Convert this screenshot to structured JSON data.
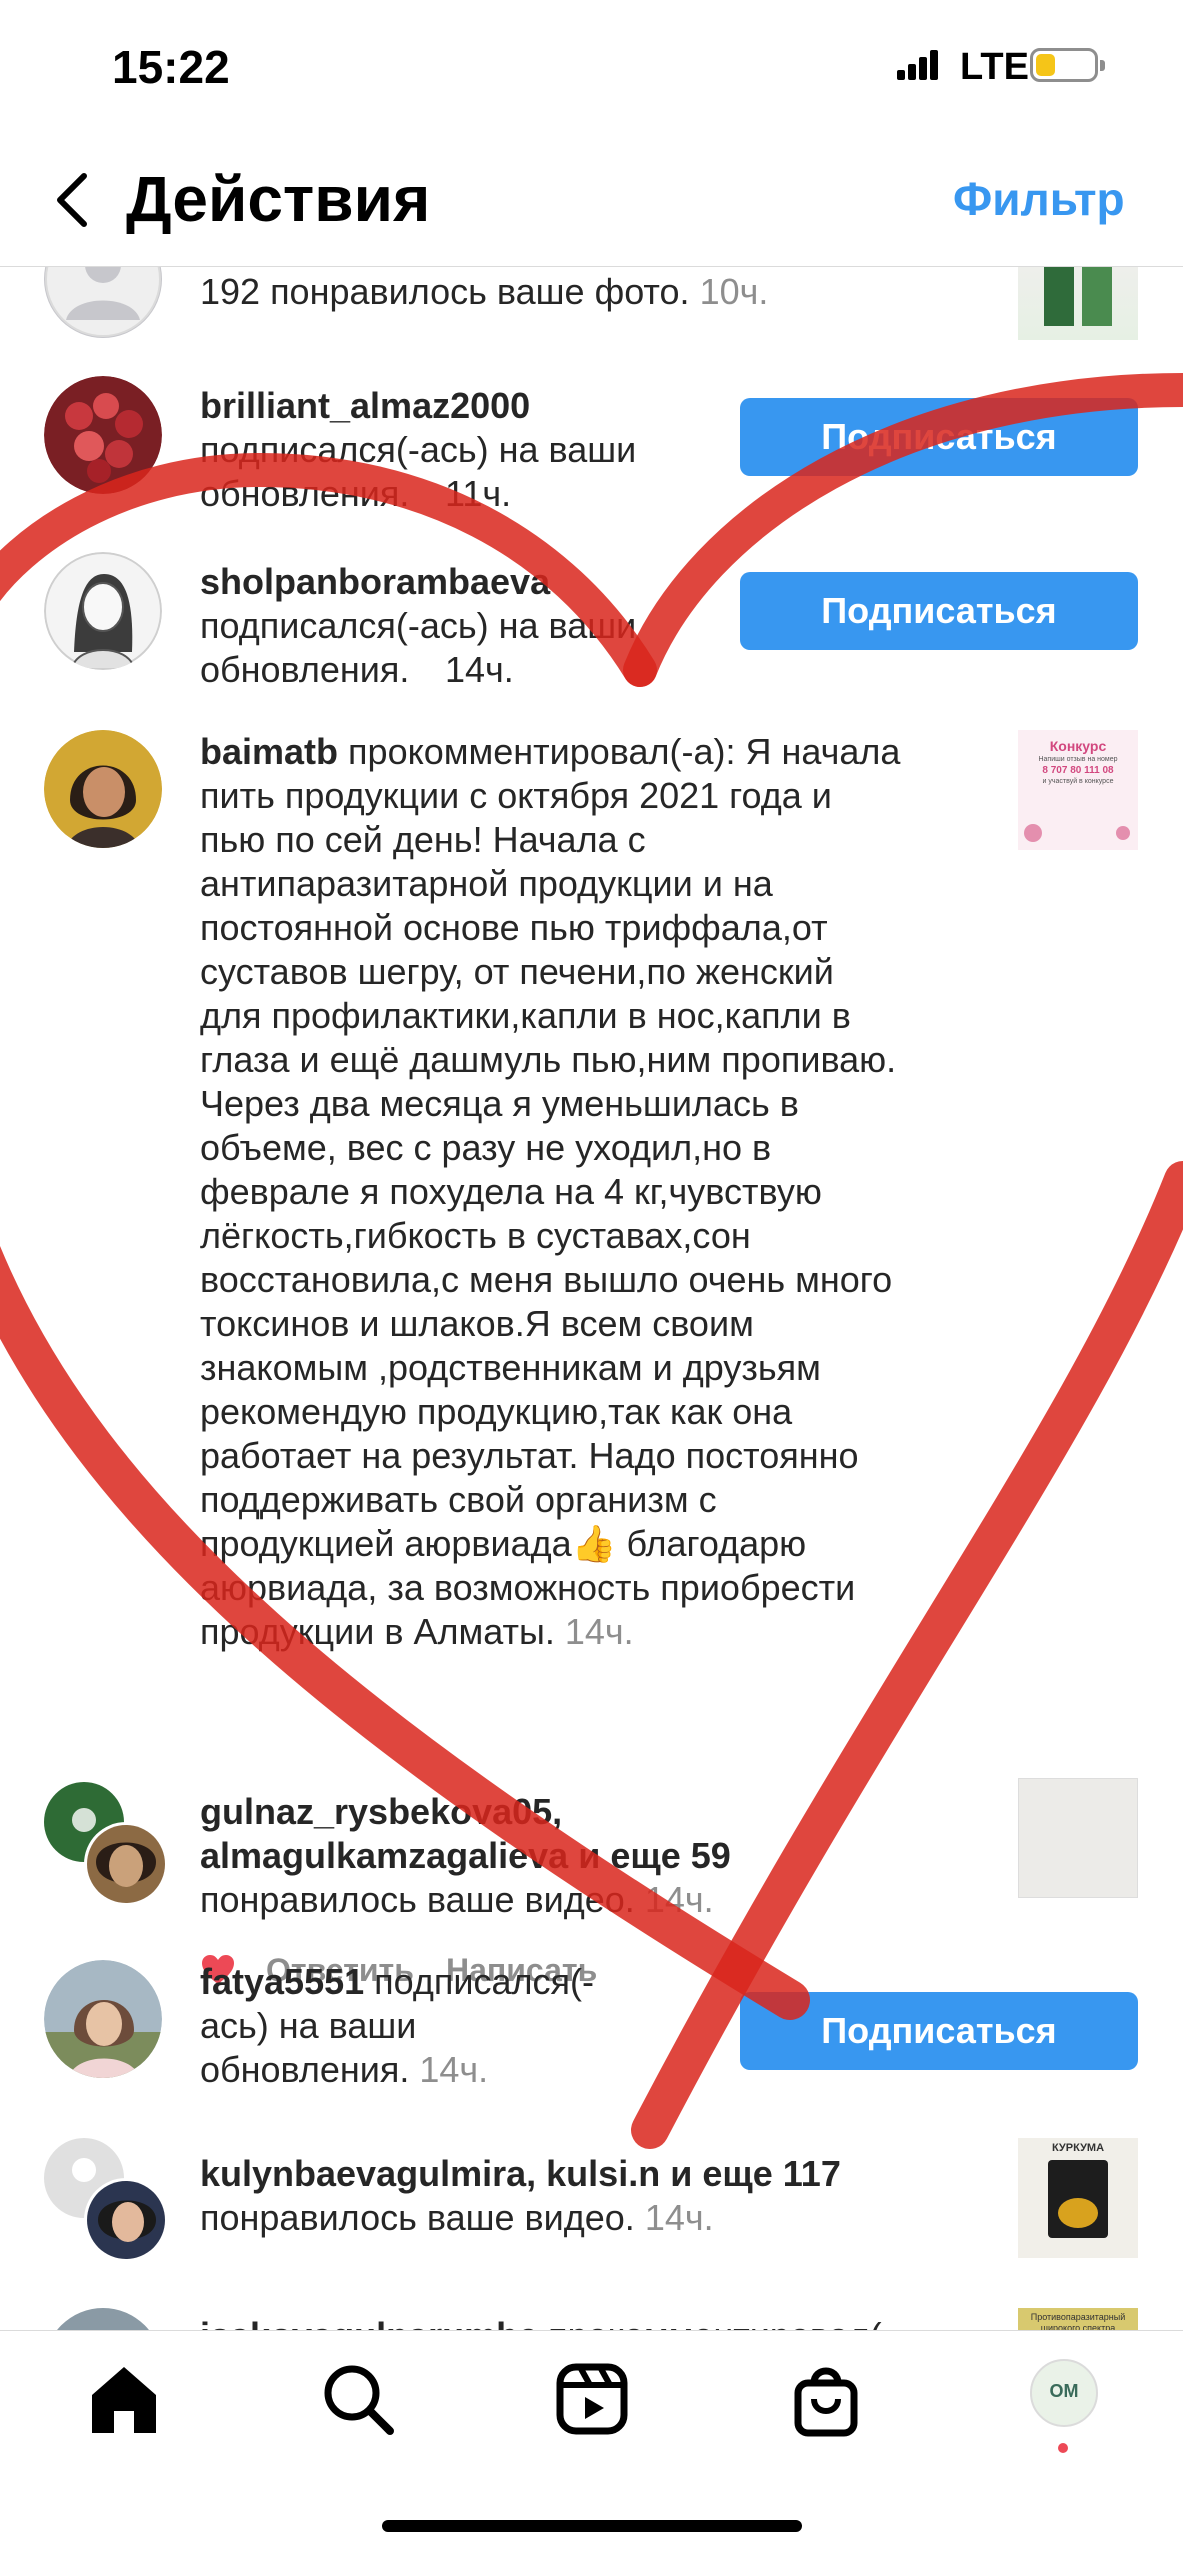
{
  "status": {
    "time": "15:22",
    "network": "LTE"
  },
  "header": {
    "title": "Действия",
    "filter": "Фильтр"
  },
  "rows": [
    {
      "text": "192 понравилось ваше фото.",
      "time": "10ч."
    },
    {
      "user": "brilliant_almaz2000",
      "text": "подписался(-ась) на ваши обновления.",
      "time": "11ч.",
      "button": "Подписаться"
    },
    {
      "user": "sholpanborambaeva",
      "text": "подписался(-ась) на ваши обновления.",
      "time": "14ч.",
      "button": "Подписаться"
    },
    {
      "user": "baimatb",
      "lines": [
        "прокомментировал(-а): Я начала",
        "пить  продукции с октября 2021 года и",
        "пью по сей день! Начала с",
        "антипаразитарной продукции и на",
        "постоянной основе пью триффала,от",
        "суставов шегру, от печени,по женский",
        "для профилактики,капли в нос,капли в",
        "глаза и ещё дашмуль пью,ним пропиваю.",
        "Через два месяца я уменьшилась в",
        "объеме, вес с разу не уходил,но в",
        "феврале я похудела на 4 кг,чувствую",
        "лёгкость,гибкость в суставах,сон",
        "восстановила,с меня вышло очень много",
        "токсинов и шлаков.Я всем своим",
        "знакомым ,родственникам и друзьям",
        "рекомендую продукцию,так как она",
        "работает на результат. Надо постоянно",
        "поддерживать свой организм с",
        "продукцией аюрвиада👍 благодарю",
        "аюрвиада, за возможность приобрести",
        "продукции в Алматы."
      ],
      "time": "14ч.",
      "reply": "Ответить",
      "write": "Написать",
      "thumb_title": "Конкурс",
      "thumb_sub": "Напиши отзыв на номер",
      "thumb_phone": "8 707 80 111 08",
      "thumb_note": "и участвуй в конкурсе"
    },
    {
      "user1": "gulnaz_rysbekova05,",
      "user2": "almagulkamzagalieva",
      "more": "и еще 59",
      "text": "понравилось ваше видео.",
      "time": "14ч."
    },
    {
      "user": "fatya5551",
      "text1": "подписался(-",
      "text2": "ась) на ваши",
      "text3": "обновления.",
      "time": "14ч.",
      "button": "Подписаться"
    },
    {
      "user1": "kulynbaevagulmira,",
      "user2": "kulsi.n",
      "more": "и еще 117",
      "text": "понравилось ваше видео.",
      "time": "14ч.",
      "thumb_title": "КУРКУМА"
    },
    {
      "user": "isakovagulnarumbe",
      "text": "прокомментировал(",
      "thumb_title": "Противопаразитарный широкого спектра"
    }
  ],
  "profile_thumb_label": "OM"
}
